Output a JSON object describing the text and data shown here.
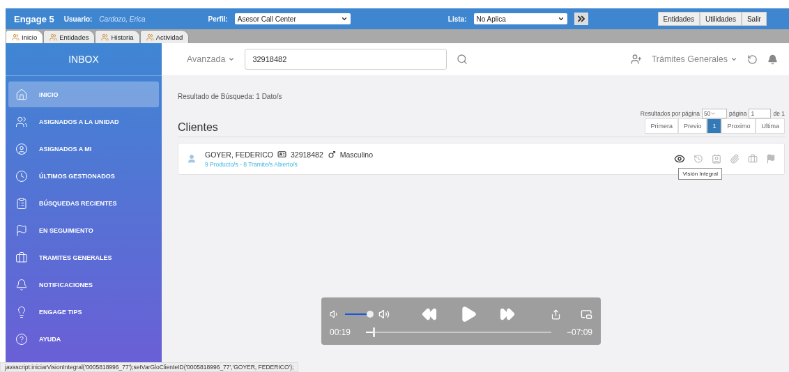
{
  "header": {
    "app_name": "Engage 5",
    "user_label": "Usuario:",
    "user_name": "Cardozo, Erica",
    "profile_label": "Perfil:",
    "profile_value": "Asesor Call Center",
    "list_label": "Lista:",
    "list_value": "No Aplica",
    "buttons": [
      "Entidades",
      "Utilidades",
      "Salir"
    ]
  },
  "tabs": [
    {
      "label": "Inicio",
      "selected": true
    },
    {
      "label": "Entidades",
      "selected": false
    },
    {
      "label": "Historia",
      "selected": false
    },
    {
      "label": "Actividad",
      "selected": false
    }
  ],
  "sidebar": {
    "title": "INBOX",
    "items": [
      {
        "label": "INICIO",
        "selected": true
      },
      {
        "label": "ASIGNADOS A LA UNIDAD",
        "selected": false
      },
      {
        "label": "ASIGNADOS A MI",
        "selected": false
      },
      {
        "label": "ÚLTIMOS GESTIONADOS",
        "selected": false
      },
      {
        "label": "BÚSQUEDAS RECIENTES",
        "selected": false
      },
      {
        "label": "EN SEGUIMIENTO",
        "selected": false
      },
      {
        "label": "TRAMITES GENERALES",
        "selected": false
      },
      {
        "label": "NOTIFICACIONES",
        "selected": false
      },
      {
        "label": "ENGAGE TIPS",
        "selected": false
      },
      {
        "label": "AYUDA",
        "selected": false
      }
    ]
  },
  "search": {
    "mode": "Avanzada",
    "value": "32918482",
    "menu": "Trámites Generales"
  },
  "results": {
    "summary": "Resultado de Búsqueda: 1 Dato/s",
    "per_page_label": "Resultados por página",
    "per_page": "50",
    "page_label": "página",
    "page": "1",
    "page_total": "de 1",
    "section": "Clientes",
    "pagination": [
      {
        "label": "Primera",
        "selected": false
      },
      {
        "label": "Previo",
        "selected": false
      },
      {
        "label": "1",
        "selected": true
      },
      {
        "label": "Proximo",
        "selected": false
      },
      {
        "label": "Ultima",
        "selected": false
      }
    ],
    "clients": [
      {
        "name": "GOYER, FEDERICO",
        "document": "32918482",
        "gender": "Masculino",
        "summary": "9 Producto/s - 8 Tramite/s Abierto/s"
      }
    ],
    "tooltip": "Visión Integral"
  },
  "player": {
    "volume": {
      "level": 0.9
    },
    "elapsed": "00:19",
    "remaining": "−07:09",
    "progress": {
      "level": 0.04
    }
  },
  "status_bar": "javascript:iniciarVisionIntegral('0005818996_77');setVarGloClienteID('0005818996_77','GOYER, FEDERICO');"
}
